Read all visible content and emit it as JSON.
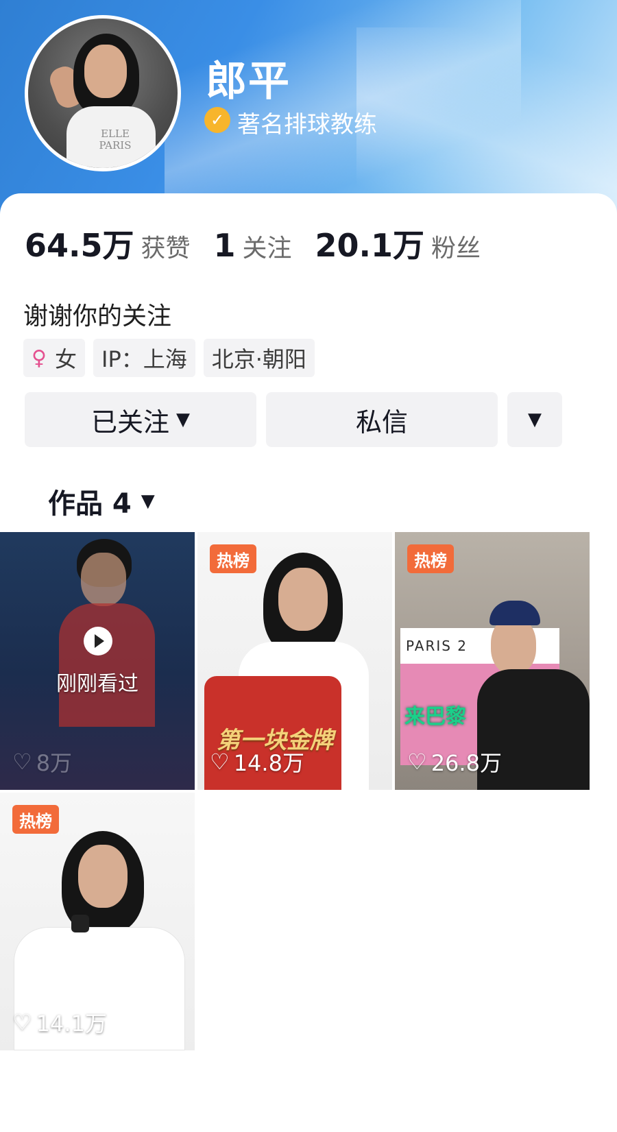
{
  "profile": {
    "name": "郎平",
    "verified_label": "著名排球教练",
    "verified_icon": "check-icon",
    "avatar_shirt_text": "ELLE PARIS"
  },
  "stats": {
    "likes_num": "64.5万",
    "likes_label": "获赞",
    "following_num": "1",
    "following_label": "关注",
    "followers_num": "20.1万",
    "followers_label": "粉丝"
  },
  "bio": "谢谢你的关注",
  "tags": {
    "gender_icon": "female-icon",
    "gender": "女",
    "ip": "IP：上海",
    "location": "北京·朝阳"
  },
  "actions": {
    "follow_label": "已关注",
    "message_label": "私信",
    "more_icon": "caret-down-icon"
  },
  "works": {
    "label": "作品 4"
  },
  "videos": [
    {
      "badge": "",
      "watched_label": "刚刚看过",
      "likes": "8万"
    },
    {
      "badge": "热榜",
      "likes": "14.8万",
      "overlay_text": "第一块金牌"
    },
    {
      "badge": "热榜",
      "likes": "26.8万",
      "sign_text": "PARIS 2",
      "overlay_text": "来巴黎"
    },
    {
      "badge": "热榜",
      "likes": "14.1万"
    }
  ],
  "colors": {
    "header_start": "#2f7fd3",
    "badge": "#f26b3a",
    "verified": "#f7b52c",
    "female": "#e4508f"
  }
}
